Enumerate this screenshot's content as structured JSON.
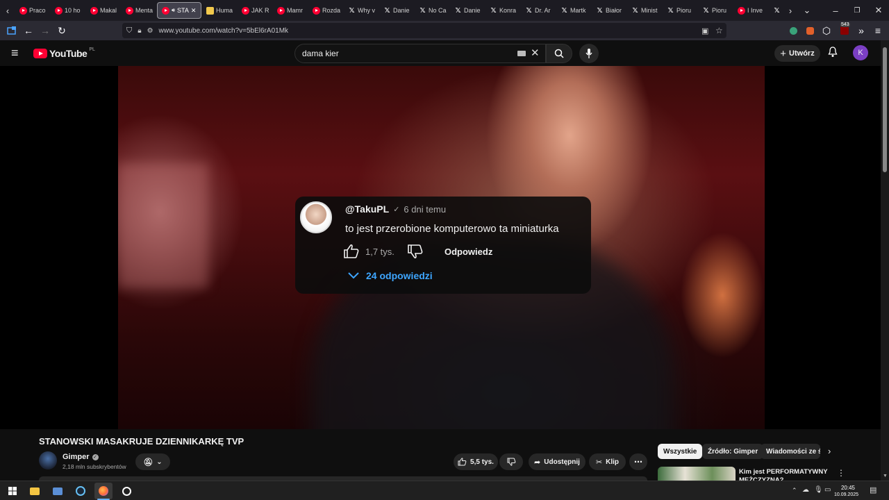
{
  "browser": {
    "tabs": [
      {
        "label": "Praco",
        "icon": "youtube-icon"
      },
      {
        "label": "10 ho",
        "icon": "youtube-icon"
      },
      {
        "label": "Makal",
        "icon": "youtube-icon"
      },
      {
        "label": "Menta",
        "icon": "youtube-icon"
      },
      {
        "label": "STA",
        "icon": "youtube-icon",
        "active": true
      },
      {
        "label": "Huma",
        "icon": "warning-icon"
      },
      {
        "label": "JAK R",
        "icon": "youtube-icon"
      },
      {
        "label": "Mamr",
        "icon": "youtube-icon"
      },
      {
        "label": "Rozda",
        "icon": "youtube-icon"
      },
      {
        "label": "Why v",
        "icon": "x-icon"
      },
      {
        "label": "Danie",
        "icon": "x-icon"
      },
      {
        "label": "No Ca",
        "icon": "x-icon"
      },
      {
        "label": "Danie",
        "icon": "x-icon"
      },
      {
        "label": "Konra",
        "icon": "x-icon"
      },
      {
        "label": "Dr. Ar",
        "icon": "x-icon"
      },
      {
        "label": "Martk",
        "icon": "x-icon"
      },
      {
        "label": "Białor",
        "icon": "x-icon"
      },
      {
        "label": "Minist",
        "icon": "x-icon"
      },
      {
        "label": "Pioru",
        "icon": "x-icon"
      },
      {
        "label": "Pioru",
        "icon": "x-icon"
      },
      {
        "label": "I Inve",
        "icon": "youtube-icon"
      },
      {
        "label": "",
        "icon": "x-icon"
      }
    ],
    "url": "www.youtube.com/watch?v=5bEl6rA01Mk",
    "badge_count": "543"
  },
  "youtube": {
    "logo": "YouTube",
    "region": "PL",
    "search_value": "dama kier",
    "create_label": "Utwórz",
    "avatar_letter": "K"
  },
  "comment": {
    "author": "@TakuPL",
    "time": "6 dni temu",
    "text": "to jest przerobione komputerowo ta miniaturka",
    "likes": "1,7 tys.",
    "reply_label": "Odpowiedz",
    "replies_label": "24 odpowiedzi"
  },
  "video": {
    "title": "STANOWSKI MASAKRUJE DZIENNIKARKĘ TVP",
    "channel": "Gimper",
    "subscribers": "2,18 mln subskrybentów",
    "likes": "5,5 tys.",
    "share_label": "Udostępnij",
    "clip_label": "Klip"
  },
  "sidebar": {
    "chips": [
      "Wszystkie",
      "Źródło: Gimper",
      "Wiadomości ze św"
    ],
    "next_video_title": "Kim jest PERFORMATYWNY",
    "next_video_title_line2": "MĘŻCZYZNA?"
  },
  "taskbar": {
    "time": "20:45",
    "date": "10.09.2025"
  }
}
